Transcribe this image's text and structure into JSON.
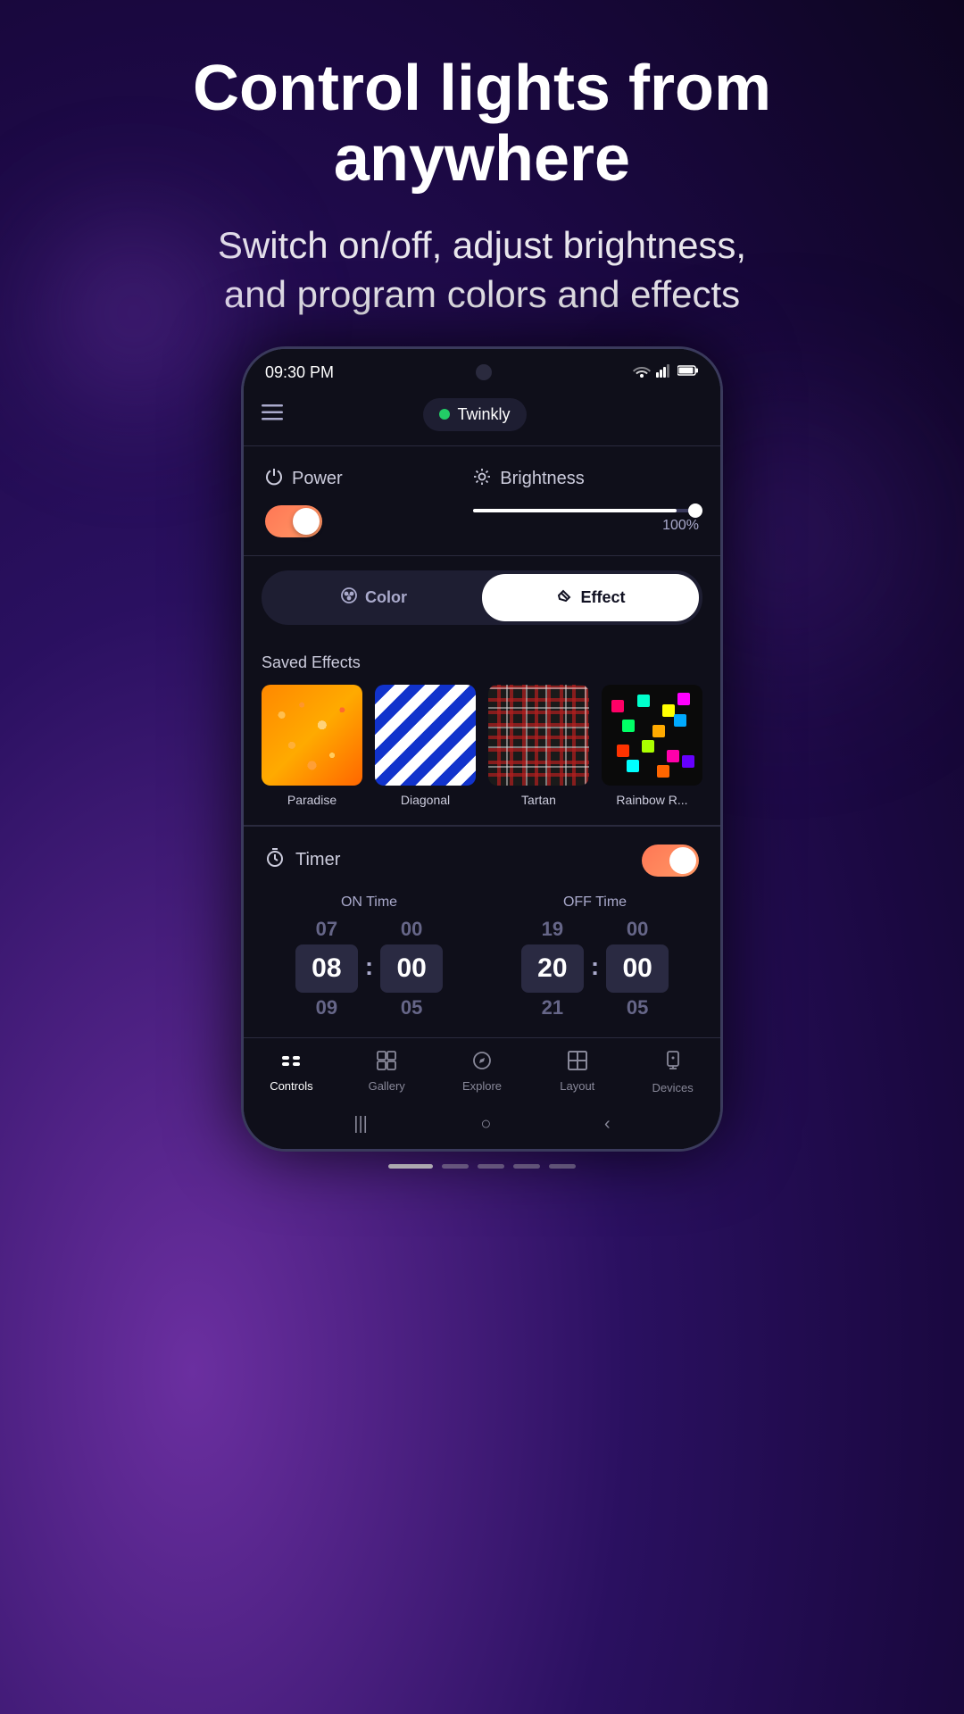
{
  "page": {
    "title": "Control lights from anywhere",
    "subtitle": "Switch on/off, adjust brightness,\nand program colors and effects"
  },
  "status_bar": {
    "time": "09:30 PM",
    "wifi": "wifi",
    "signal": "signal",
    "battery": "battery"
  },
  "top_bar": {
    "device_name": "Twinkly",
    "device_connected": true
  },
  "power": {
    "label": "Power",
    "enabled": true
  },
  "brightness": {
    "label": "Brightness",
    "value": "100%",
    "percent": 90
  },
  "tabs": {
    "color_label": "Color",
    "effect_label": "Effect",
    "active": "effect"
  },
  "effects": {
    "section_title": "Saved Effects",
    "items": [
      {
        "name": "Paradise",
        "type": "paradise"
      },
      {
        "name": "Diagonal",
        "type": "diagonal"
      },
      {
        "name": "Tartan",
        "type": "tartan"
      },
      {
        "name": "Rainbow R...",
        "type": "rainbow"
      }
    ]
  },
  "timer": {
    "label": "Timer",
    "enabled": true,
    "on_time": {
      "label": "ON Time",
      "hour": {
        "prev": "07",
        "current": "08",
        "next": "09"
      },
      "minute": {
        "prev": "00",
        "current": "00",
        "next": "05"
      }
    },
    "off_time": {
      "label": "OFF Time",
      "hour": {
        "prev": "19",
        "current": "20",
        "next": "21"
      },
      "minute": {
        "prev": "00",
        "current": "00",
        "next": "05"
      }
    }
  },
  "bottom_nav": {
    "items": [
      {
        "id": "controls",
        "label": "Controls",
        "active": true
      },
      {
        "id": "gallery",
        "label": "Gallery",
        "active": false
      },
      {
        "id": "explore",
        "label": "Explore",
        "active": false
      },
      {
        "id": "layout",
        "label": "Layout",
        "active": false
      },
      {
        "id": "devices",
        "label": "Devices",
        "active": false
      }
    ]
  },
  "page_indicator": {
    "dots": 5,
    "active_index": 0
  }
}
